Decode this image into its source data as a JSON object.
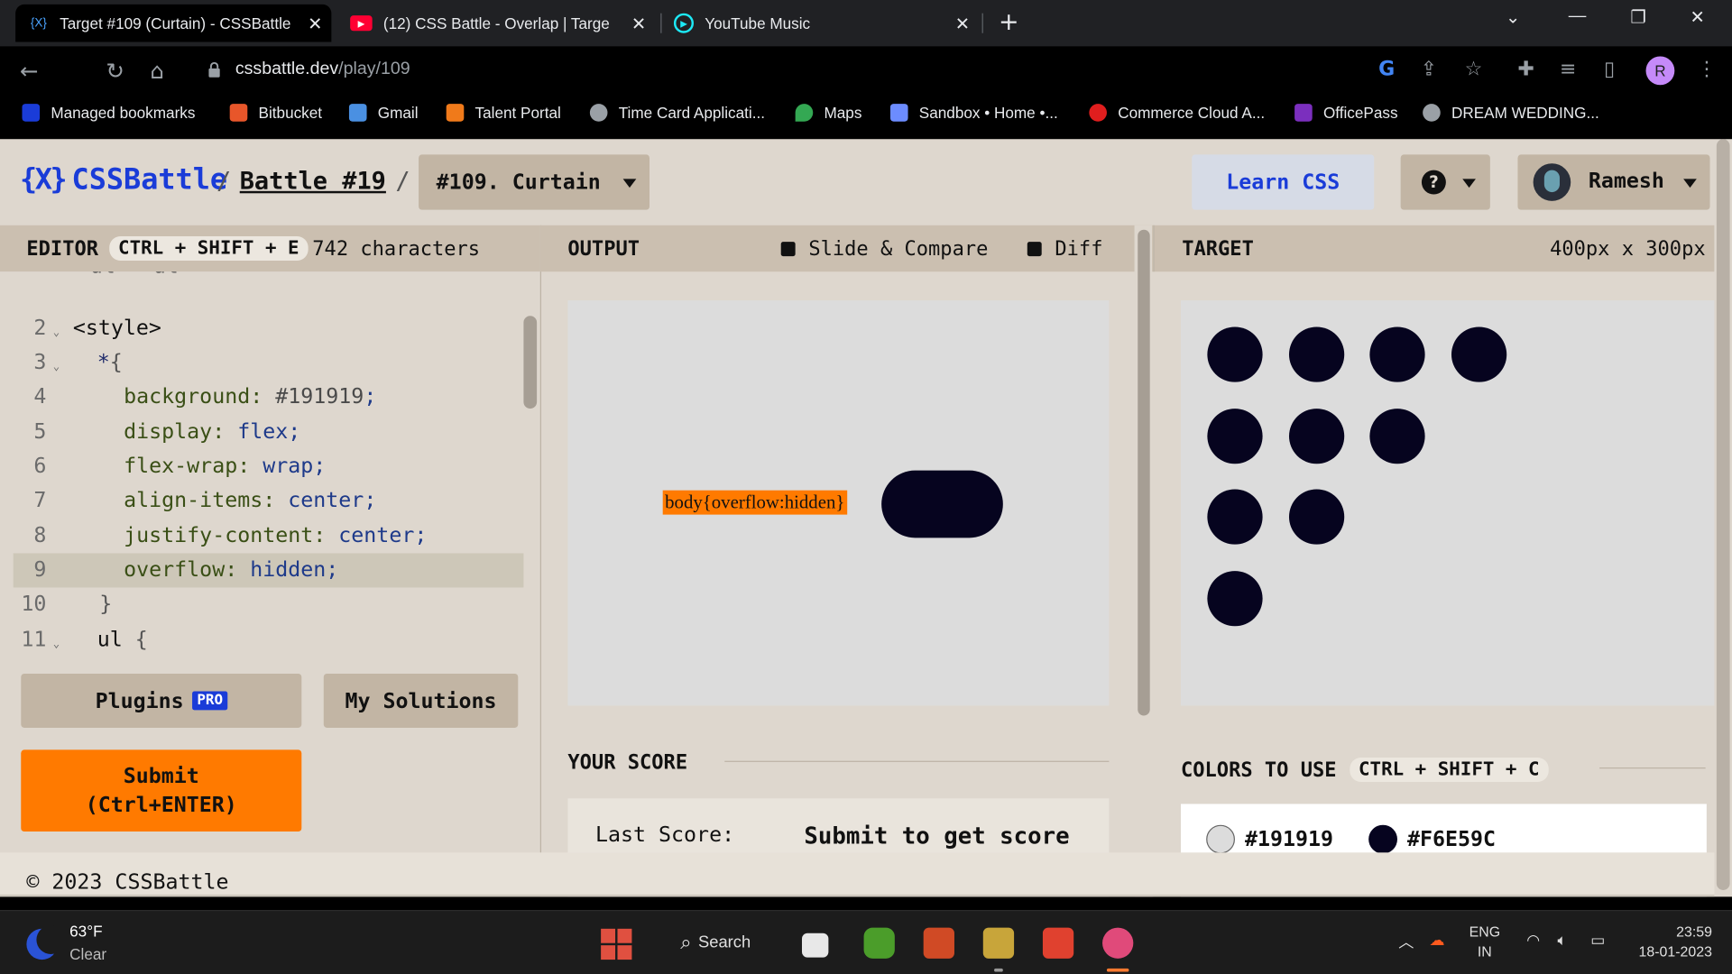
{
  "browser": {
    "tabs": [
      {
        "title": "Target #109 (Curtain) - CSSBattle",
        "favicon": "cssbattle-icon",
        "active": true
      },
      {
        "title": "(12) CSS Battle - Overlap | Targe",
        "favicon": "youtube-icon",
        "active": false
      },
      {
        "title": "YouTube Music",
        "favicon": "youtube-music-icon",
        "active": false
      }
    ],
    "url_host": "cssbattle.dev",
    "url_path": "/play/109",
    "profile_initial": "R",
    "bookmarks": [
      {
        "label": "Managed bookmarks",
        "icon": "folder-icon",
        "color": "#1a3cd8"
      },
      {
        "label": "Bitbucket",
        "icon": "bitbucket-icon",
        "color": "#e8562a"
      },
      {
        "label": "Gmail",
        "icon": "gmail-icon",
        "color": "#4a90e2"
      },
      {
        "label": "Talent Portal",
        "icon": "talent-portal-icon",
        "color": "#f07a1a"
      },
      {
        "label": "Time Card Applicati...",
        "icon": "globe-icon",
        "color": "#9aa0a6"
      },
      {
        "label": "Maps",
        "icon": "maps-icon",
        "color": "#34a853"
      },
      {
        "label": "Sandbox • Home •...",
        "icon": "sandbox-icon",
        "color": "#6c8cff"
      },
      {
        "label": "Commerce Cloud A...",
        "icon": "salesforce-icon",
        "color": "#e01e1e"
      },
      {
        "label": "OfficePass",
        "icon": "officepass-icon",
        "color": "#7b2fbe"
      },
      {
        "label": "DREAM WEDDING...",
        "icon": "globe-icon",
        "color": "#9aa0a6"
      }
    ]
  },
  "header": {
    "logo_glyph": "{X}",
    "logo_text": "CSSBattle",
    "battle_link": "Battle #19",
    "target_select": "#109. Curtain",
    "learn_label": "Learn CSS",
    "help_glyph": "?",
    "user_name": "Ramesh"
  },
  "editor": {
    "title": "EDITOR",
    "shortcut": "CTRL + SHIFT + E",
    "chars": "742 characters",
    "top_partial": "<ul> <ul>",
    "lines": [
      {
        "n": "2",
        "fold": true
      },
      {
        "n": "3",
        "fold": true
      },
      {
        "n": "4"
      },
      {
        "n": "5"
      },
      {
        "n": "6"
      },
      {
        "n": "7"
      },
      {
        "n": "8"
      },
      {
        "n": "9",
        "highlight": true
      },
      {
        "n": "10"
      },
      {
        "n": "11",
        "fold": true
      }
    ],
    "code": {
      "l2_tag": "<style>",
      "l3_sel": "*",
      "l3_brace": "{",
      "l4_prop": "background:",
      "l4_val": "#191919",
      "l5_prop": "display:",
      "l5_val": "flex",
      "l6_prop": "flex-wrap:",
      "l6_val": "wrap",
      "l7_prop": "align-items:",
      "l7_val": "center",
      "l8_prop": "justify-content:",
      "l8_val": "center",
      "l9_prop": "overflow:",
      "l9_val": "hidden",
      "semi": ";",
      "l10_brace": "}",
      "l11_sel": "ul",
      "l11_brace": "{"
    },
    "plugins_label": "Plugins",
    "pro_badge": "PRO",
    "my_solutions_label": "My Solutions",
    "submit_line1": "Submit",
    "submit_line2": "(Ctrl+ENTER)"
  },
  "output": {
    "title": "OUTPUT",
    "slide_compare": "Slide & Compare",
    "diff": "Diff",
    "rendered_text": "body{overflow:hidden}",
    "score_title": "YOUR SCORE",
    "last_score_label": "Last Score:",
    "last_score_value": "Submit to get score"
  },
  "target": {
    "title": "TARGET",
    "dimensions": "400px x 300px",
    "dot_color": "#06041f",
    "dot_rows": [
      4,
      3,
      2,
      1
    ],
    "colors_title": "COLORS TO USE",
    "colors_shortcut": "CTRL + SHIFT + C",
    "colors": [
      {
        "hex": "#191919",
        "swatch": "#dcdcdc"
      },
      {
        "hex": "#F6E59C",
        "swatch": "#06041f"
      }
    ]
  },
  "footer": {
    "copyright": "© 2023 CSSBattle"
  },
  "taskbar": {
    "temp": "63°F",
    "condition": "Clear",
    "search_label": "Search",
    "lang_line1": "ENG",
    "lang_line2": "IN",
    "time": "23:59",
    "date": "18-01-2023"
  },
  "colors": {
    "accent_blue": "#1a3cd8",
    "submit_orange": "#ff7a00",
    "page_bg": "#ded7ce",
    "panel_head_bg": "#cbbfb0",
    "button_bg": "#c2b5a4"
  }
}
